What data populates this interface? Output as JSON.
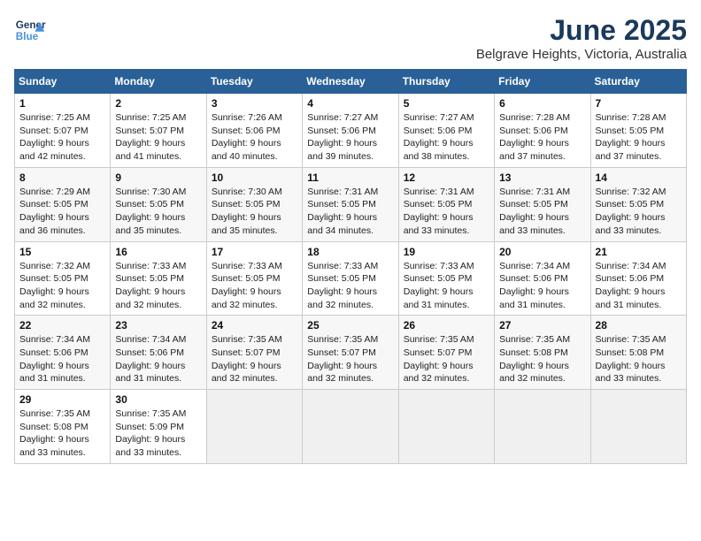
{
  "header": {
    "logo_line1": "General",
    "logo_line2": "Blue",
    "title": "June 2025",
    "subtitle": "Belgrave Heights, Victoria, Australia"
  },
  "weekdays": [
    "Sunday",
    "Monday",
    "Tuesday",
    "Wednesday",
    "Thursday",
    "Friday",
    "Saturday"
  ],
  "weeks": [
    [
      {
        "day": "1",
        "info": "Sunrise: 7:25 AM\nSunset: 5:07 PM\nDaylight: 9 hours\nand 42 minutes."
      },
      {
        "day": "2",
        "info": "Sunrise: 7:25 AM\nSunset: 5:07 PM\nDaylight: 9 hours\nand 41 minutes."
      },
      {
        "day": "3",
        "info": "Sunrise: 7:26 AM\nSunset: 5:06 PM\nDaylight: 9 hours\nand 40 minutes."
      },
      {
        "day": "4",
        "info": "Sunrise: 7:27 AM\nSunset: 5:06 PM\nDaylight: 9 hours\nand 39 minutes."
      },
      {
        "day": "5",
        "info": "Sunrise: 7:27 AM\nSunset: 5:06 PM\nDaylight: 9 hours\nand 38 minutes."
      },
      {
        "day": "6",
        "info": "Sunrise: 7:28 AM\nSunset: 5:06 PM\nDaylight: 9 hours\nand 37 minutes."
      },
      {
        "day": "7",
        "info": "Sunrise: 7:28 AM\nSunset: 5:05 PM\nDaylight: 9 hours\nand 37 minutes."
      }
    ],
    [
      {
        "day": "8",
        "info": "Sunrise: 7:29 AM\nSunset: 5:05 PM\nDaylight: 9 hours\nand 36 minutes."
      },
      {
        "day": "9",
        "info": "Sunrise: 7:30 AM\nSunset: 5:05 PM\nDaylight: 9 hours\nand 35 minutes."
      },
      {
        "day": "10",
        "info": "Sunrise: 7:30 AM\nSunset: 5:05 PM\nDaylight: 9 hours\nand 35 minutes."
      },
      {
        "day": "11",
        "info": "Sunrise: 7:31 AM\nSunset: 5:05 PM\nDaylight: 9 hours\nand 34 minutes."
      },
      {
        "day": "12",
        "info": "Sunrise: 7:31 AM\nSunset: 5:05 PM\nDaylight: 9 hours\nand 33 minutes."
      },
      {
        "day": "13",
        "info": "Sunrise: 7:31 AM\nSunset: 5:05 PM\nDaylight: 9 hours\nand 33 minutes."
      },
      {
        "day": "14",
        "info": "Sunrise: 7:32 AM\nSunset: 5:05 PM\nDaylight: 9 hours\nand 33 minutes."
      }
    ],
    [
      {
        "day": "15",
        "info": "Sunrise: 7:32 AM\nSunset: 5:05 PM\nDaylight: 9 hours\nand 32 minutes."
      },
      {
        "day": "16",
        "info": "Sunrise: 7:33 AM\nSunset: 5:05 PM\nDaylight: 9 hours\nand 32 minutes."
      },
      {
        "day": "17",
        "info": "Sunrise: 7:33 AM\nSunset: 5:05 PM\nDaylight: 9 hours\nand 32 minutes."
      },
      {
        "day": "18",
        "info": "Sunrise: 7:33 AM\nSunset: 5:05 PM\nDaylight: 9 hours\nand 32 minutes."
      },
      {
        "day": "19",
        "info": "Sunrise: 7:33 AM\nSunset: 5:05 PM\nDaylight: 9 hours\nand 31 minutes."
      },
      {
        "day": "20",
        "info": "Sunrise: 7:34 AM\nSunset: 5:06 PM\nDaylight: 9 hours\nand 31 minutes."
      },
      {
        "day": "21",
        "info": "Sunrise: 7:34 AM\nSunset: 5:06 PM\nDaylight: 9 hours\nand 31 minutes."
      }
    ],
    [
      {
        "day": "22",
        "info": "Sunrise: 7:34 AM\nSunset: 5:06 PM\nDaylight: 9 hours\nand 31 minutes."
      },
      {
        "day": "23",
        "info": "Sunrise: 7:34 AM\nSunset: 5:06 PM\nDaylight: 9 hours\nand 31 minutes."
      },
      {
        "day": "24",
        "info": "Sunrise: 7:35 AM\nSunset: 5:07 PM\nDaylight: 9 hours\nand 32 minutes."
      },
      {
        "day": "25",
        "info": "Sunrise: 7:35 AM\nSunset: 5:07 PM\nDaylight: 9 hours\nand 32 minutes."
      },
      {
        "day": "26",
        "info": "Sunrise: 7:35 AM\nSunset: 5:07 PM\nDaylight: 9 hours\nand 32 minutes."
      },
      {
        "day": "27",
        "info": "Sunrise: 7:35 AM\nSunset: 5:08 PM\nDaylight: 9 hours\nand 32 minutes."
      },
      {
        "day": "28",
        "info": "Sunrise: 7:35 AM\nSunset: 5:08 PM\nDaylight: 9 hours\nand 33 minutes."
      }
    ],
    [
      {
        "day": "29",
        "info": "Sunrise: 7:35 AM\nSunset: 5:08 PM\nDaylight: 9 hours\nand 33 minutes."
      },
      {
        "day": "30",
        "info": "Sunrise: 7:35 AM\nSunset: 5:09 PM\nDaylight: 9 hours\nand 33 minutes."
      },
      {
        "day": "",
        "info": ""
      },
      {
        "day": "",
        "info": ""
      },
      {
        "day": "",
        "info": ""
      },
      {
        "day": "",
        "info": ""
      },
      {
        "day": "",
        "info": ""
      }
    ]
  ]
}
